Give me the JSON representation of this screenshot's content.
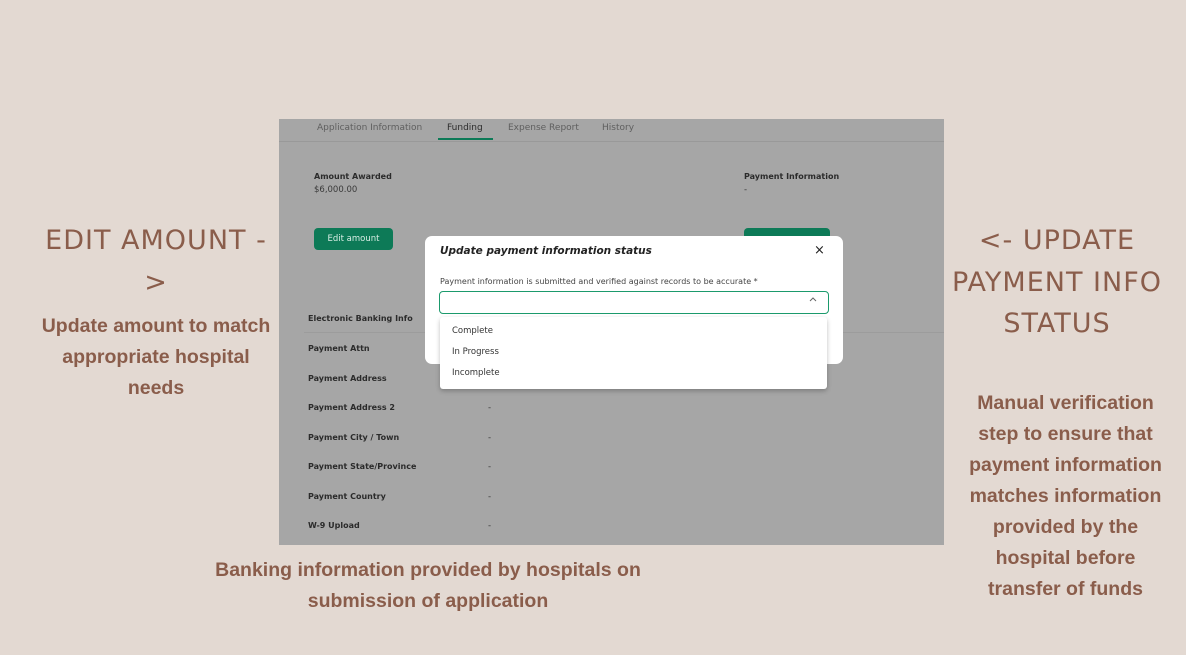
{
  "annotations": {
    "left_heading": "EDIT AMOUNT ->",
    "left_body": "Update amount to match appropriate hospital needs",
    "right_heading": "<- UPDATE PAYMENT INFO STATUS",
    "right_body": "Manual verification step to ensure that payment information matches information provided by the hospital before transfer of funds",
    "bottom_body": "Banking information provided by hospitals on submission of application"
  },
  "tabs": [
    "Application Information",
    "Funding",
    "Expense Report",
    "History"
  ],
  "active_tab": "Funding",
  "funding": {
    "amount_label": "Amount Awarded",
    "amount_value": "$6,000.00",
    "payment_label": "Payment Information",
    "payment_value": "-",
    "edit_button": "Edit amount"
  },
  "banking": {
    "section_title": "Electronic Banking Info",
    "rows": [
      {
        "label": "Payment Attn",
        "value": "-"
      },
      {
        "label": "Payment Address",
        "value": "-"
      },
      {
        "label": "Payment Address 2",
        "value": "-"
      },
      {
        "label": "Payment City / Town",
        "value": "-"
      },
      {
        "label": "Payment State/Province",
        "value": "-"
      },
      {
        "label": "Payment Country",
        "value": "-"
      },
      {
        "label": "W-9 Upload",
        "value": "-"
      }
    ]
  },
  "modal": {
    "title": "Update payment information status",
    "close": "×",
    "question": "Payment information is submitted and verified against records to be accurate *",
    "selected": "",
    "options": [
      "Complete",
      "In Progress",
      "Incomplete"
    ]
  },
  "colors": {
    "background": "#e3d9d2",
    "annotation_text": "#8a5d4b",
    "accent_green": "#0d7a57"
  }
}
